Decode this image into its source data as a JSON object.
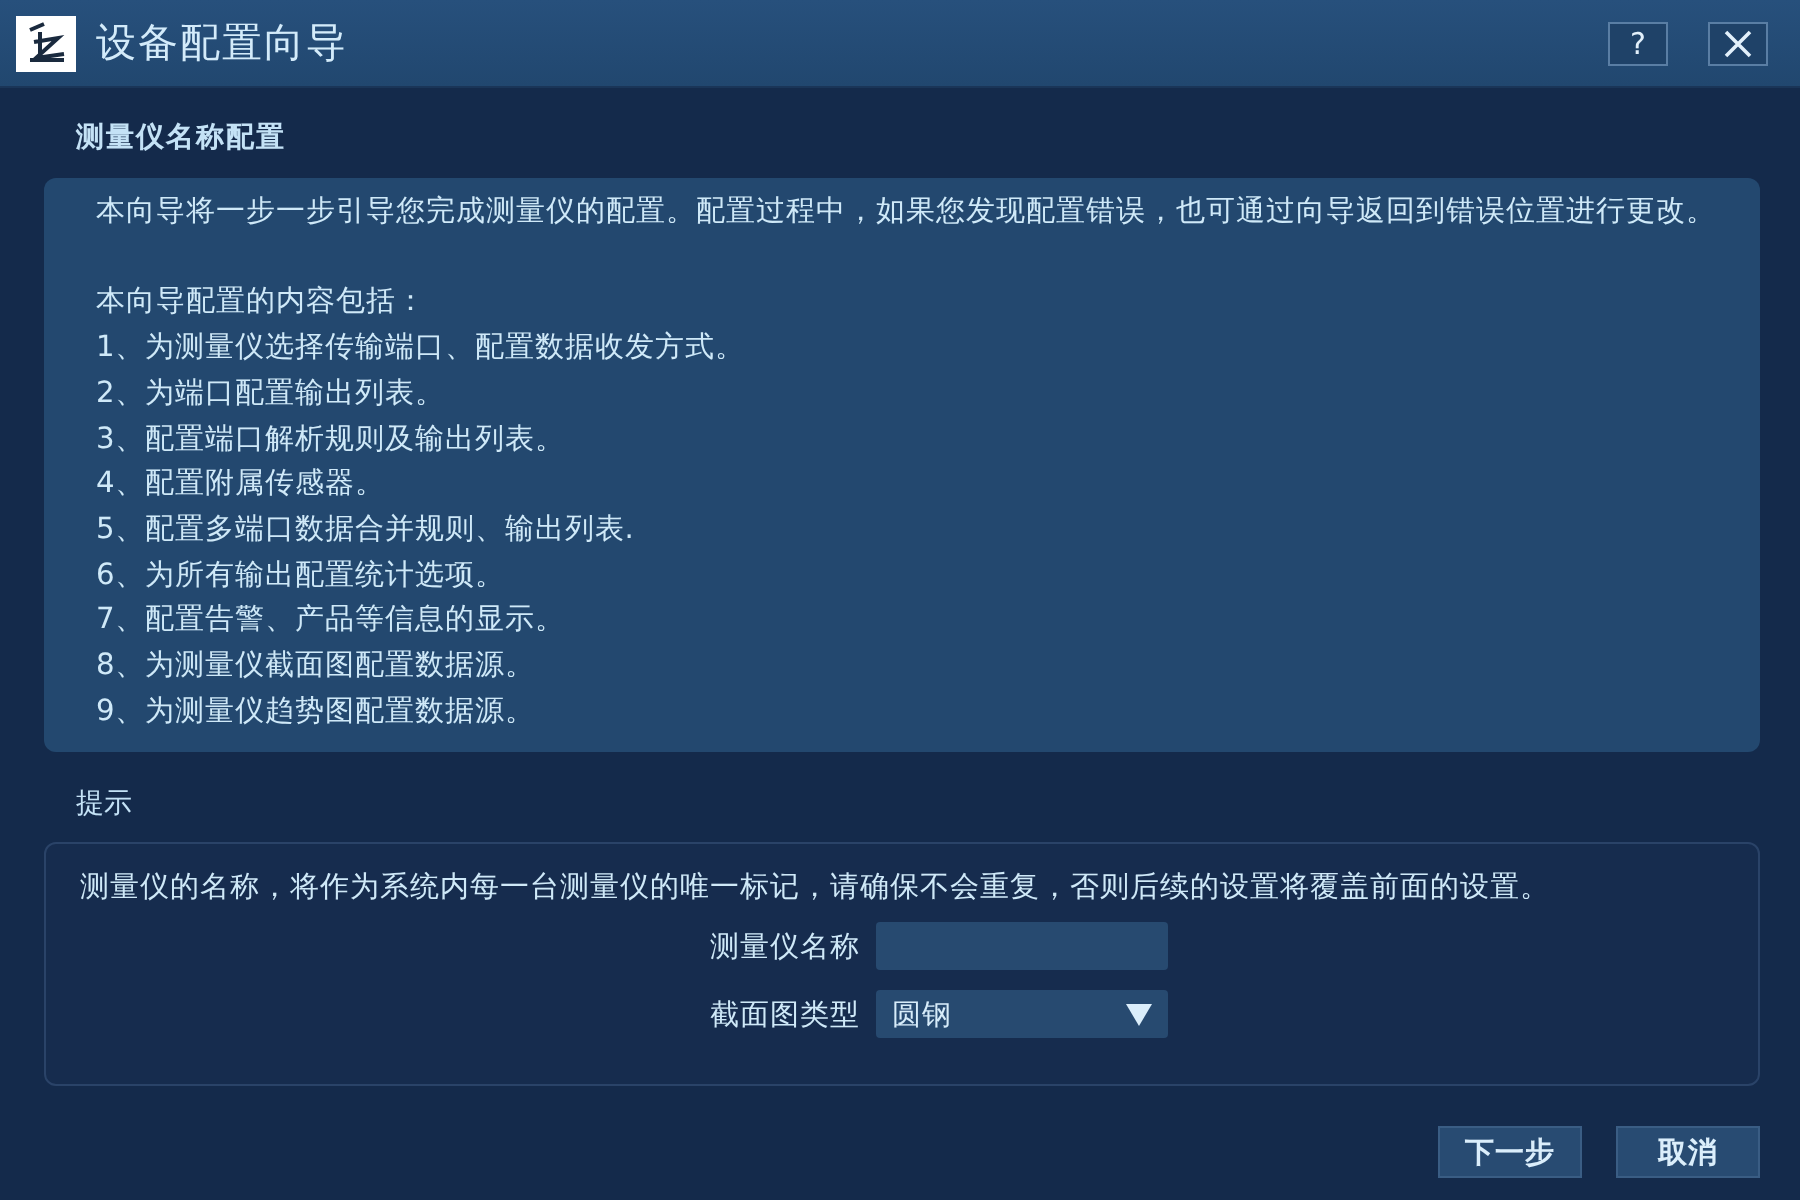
{
  "window": {
    "title": "设备配置向导",
    "title_buttons": [
      {
        "kind": "help",
        "label": "?"
      },
      {
        "kind": "close"
      }
    ]
  },
  "section_title": "测量仪名称配置",
  "intro": {
    "paragraph": "本向导将一步一步引导您完成测量仪的配置。配置过程中，如果您发现配置错误，也可通过向导返回到错误位置进行更改。",
    "list_heading": "本向导配置的内容包括：",
    "items": [
      "1、为测量仪选择传输端口、配置数据收发方式。",
      "2、为端口配置输出列表。",
      "3、配置端口解析规则及输出列表。",
      "4、配置附属传感器。",
      "5、配置多端口数据合并规则、输出列表.",
      "6、为所有输出配置统计选项。",
      "7、配置告警、产品等信息的显示。",
      "8、为测量仪截面图配置数据源。",
      "9、为测量仪趋势图配置数据源。"
    ]
  },
  "hint": {
    "title": "提示",
    "text": "测量仪的名称，将作为系统内每一台测量仪的唯一标记，请确保不会重复，否则后续的设置将覆盖前面的设置。",
    "fields": [
      {
        "kind": "text",
        "label": "测量仪名称"
      },
      {
        "kind": "select",
        "label": "截面图类型",
        "value": "圆钢"
      }
    ]
  },
  "buttons": [
    "下一步",
    "取消"
  ]
}
